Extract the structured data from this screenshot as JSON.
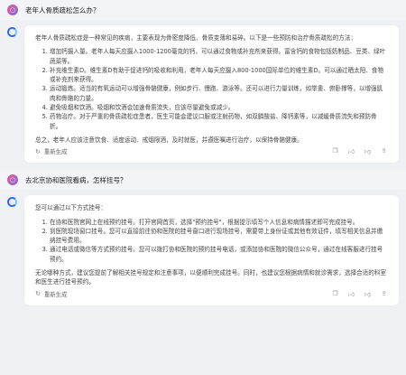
{
  "q1": {
    "text": "老年人骨质疏松怎么办？",
    "avatar": "○"
  },
  "a1": {
    "intro": "老年人骨质疏松症是一种常见的疾病，主要表现为骨密度降低、骨质变薄和易碎。以下是一些预防和治疗骨质疏松的方法：",
    "items": [
      "增加钙摄入量。老年人每天应摄入1000-1200毫克的钙，可以通过食物或补充剂来获得。富含钙的食物包括奶制品、豆类、绿叶蔬菜等。",
      "补充维生素D。维生素D有助于促进钙的吸收和利用，老年人每天应摄入800-1000国际单位的维生素D。可以通过晒太阳、食物或补充剂来获得。",
      "运动锻炼。适当的有氧运动可以增强骨骼健康，例如步行、慢跑、游泳等。还可以进行力量训练，如举重、俯卧撑等，以增强肌肉和骨骼的力量。",
      "避免吸烟和饮酒。吸烟和饮酒会加速骨质流失，应该尽量避免或减少。",
      "药物治疗。对于严重的骨质疏松症患者，医生可能会建议口服或注射药物，如双膦酸盐、降钙素等，以减缓骨质流失和预防骨折。"
    ],
    "summary": "总之，老年人应该注意饮食、适度运动、戒烟限酒，及时就医，并遵医嘱进行治疗，以保持骨骼健康。",
    "regen": "重新生成"
  },
  "q2": {
    "text": "去北京协和医院看病，怎样挂号？",
    "avatar": "○"
  },
  "a2": {
    "intro": "您可以通过以下方式挂号：",
    "items": [
      "在协和医院官网上在线预约挂号。打开官网首页，选择\"预约挂号\"，根据提示填写个人信息和病情描述即可完成挂号。",
      "到医院现场窗口挂号。您可以直接前往协和医院的挂号窗口进行现场挂号，需要带上身份证或其他有效证件，填写相关信息并缴纳挂号费用。",
      "通过电话或微信等方式预约挂号。您可以拨打协和医院的预约挂号电话，或添加协和医院的微信公众号，通过在线客服进行挂号预约。"
    ],
    "summary": "无论哪种方式，建议您提前了解相关挂号规定和注意事项，以便顺利完成挂号。同时，也建议您根据病情和就诊需求，选择合适的科室和医生进行挂号预约。",
    "regen": "重新生成"
  },
  "icons": {
    "regen": "refresh-icon",
    "copy": "copy-icon",
    "like": "thumbs-up-icon",
    "dislike": "thumbs-down-icon",
    "share": "share-icon"
  }
}
